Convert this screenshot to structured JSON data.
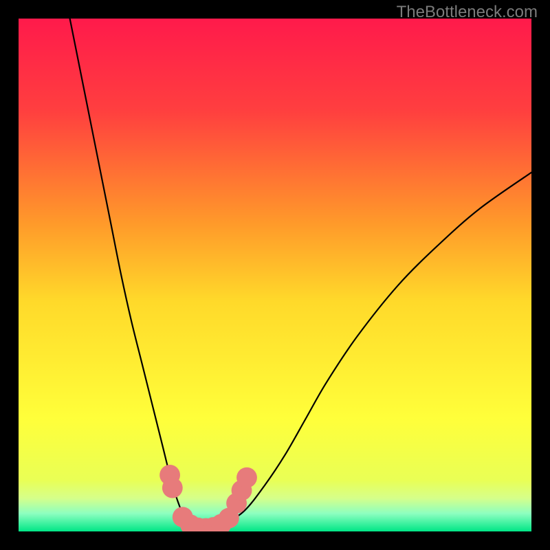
{
  "watermark": "TheBottleneck.com",
  "chart_data": {
    "type": "line",
    "title": "",
    "xlabel": "",
    "ylabel": "",
    "xlim": [
      0,
      100
    ],
    "ylim": [
      0,
      100
    ],
    "gradient_stops": [
      {
        "offset": 0,
        "color": "#ff1a4b"
      },
      {
        "offset": 0.18,
        "color": "#ff3f3f"
      },
      {
        "offset": 0.4,
        "color": "#ff9a2a"
      },
      {
        "offset": 0.55,
        "color": "#ffd92a"
      },
      {
        "offset": 0.78,
        "color": "#ffff3a"
      },
      {
        "offset": 0.9,
        "color": "#e9ff55"
      },
      {
        "offset": 0.935,
        "color": "#d6ff8a"
      },
      {
        "offset": 0.965,
        "color": "#8dffc0"
      },
      {
        "offset": 1.0,
        "color": "#00e686"
      }
    ],
    "series": [
      {
        "name": "bottleneck-curve",
        "x": [
          10,
          12,
          14,
          16,
          18,
          20,
          22,
          24,
          26,
          28,
          29.5,
          31,
          32.5,
          34,
          36,
          38,
          40,
          44,
          48,
          52,
          56,
          60,
          66,
          74,
          82,
          90,
          100
        ],
        "y": [
          100,
          90,
          80,
          70,
          60,
          50,
          41,
          33,
          25,
          17,
          11,
          6,
          2.5,
          1.2,
          0.6,
          0.6,
          1.4,
          4,
          9,
          15,
          22,
          29,
          38,
          48,
          56,
          63,
          70
        ]
      }
    ],
    "markers": {
      "name": "highlight-points",
      "color": "#e77b7b",
      "radius": 2.0,
      "points": [
        {
          "x": 29.5,
          "y": 11
        },
        {
          "x": 30.0,
          "y": 8.5
        },
        {
          "x": 32.0,
          "y": 2.8
        },
        {
          "x": 33.5,
          "y": 1.3
        },
        {
          "x": 35.0,
          "y": 0.7
        },
        {
          "x": 36.5,
          "y": 0.6
        },
        {
          "x": 38.0,
          "y": 0.8
        },
        {
          "x": 39.5,
          "y": 1.4
        },
        {
          "x": 41.0,
          "y": 2.6
        },
        {
          "x": 42.5,
          "y": 5.5
        },
        {
          "x": 43.5,
          "y": 8.0
        },
        {
          "x": 44.5,
          "y": 10.5
        }
      ]
    }
  }
}
